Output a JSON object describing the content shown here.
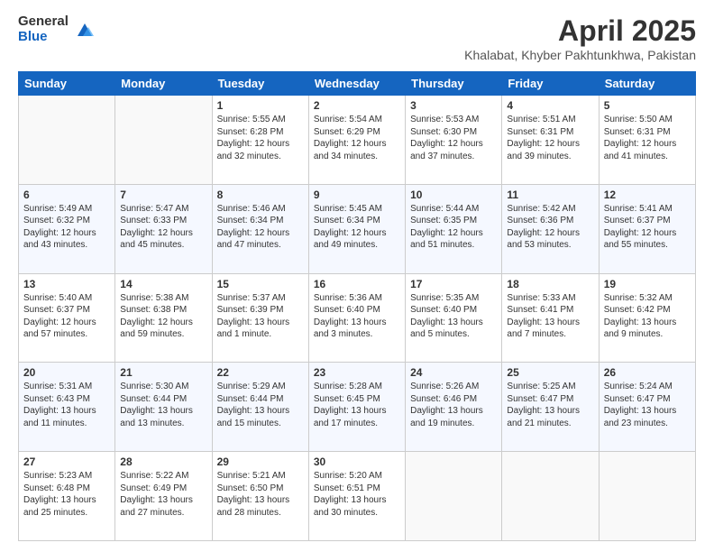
{
  "logo": {
    "general": "General",
    "blue": "Blue"
  },
  "title": "April 2025",
  "location": "Khalabat, Khyber Pakhtunkhwa, Pakistan",
  "days_of_week": [
    "Sunday",
    "Monday",
    "Tuesday",
    "Wednesday",
    "Thursday",
    "Friday",
    "Saturday"
  ],
  "weeks": [
    [
      {
        "day": "",
        "info": ""
      },
      {
        "day": "",
        "info": ""
      },
      {
        "day": "1",
        "info": "Sunrise: 5:55 AM\nSunset: 6:28 PM\nDaylight: 12 hours and 32 minutes."
      },
      {
        "day": "2",
        "info": "Sunrise: 5:54 AM\nSunset: 6:29 PM\nDaylight: 12 hours and 34 minutes."
      },
      {
        "day": "3",
        "info": "Sunrise: 5:53 AM\nSunset: 6:30 PM\nDaylight: 12 hours and 37 minutes."
      },
      {
        "day": "4",
        "info": "Sunrise: 5:51 AM\nSunset: 6:31 PM\nDaylight: 12 hours and 39 minutes."
      },
      {
        "day": "5",
        "info": "Sunrise: 5:50 AM\nSunset: 6:31 PM\nDaylight: 12 hours and 41 minutes."
      }
    ],
    [
      {
        "day": "6",
        "info": "Sunrise: 5:49 AM\nSunset: 6:32 PM\nDaylight: 12 hours and 43 minutes."
      },
      {
        "day": "7",
        "info": "Sunrise: 5:47 AM\nSunset: 6:33 PM\nDaylight: 12 hours and 45 minutes."
      },
      {
        "day": "8",
        "info": "Sunrise: 5:46 AM\nSunset: 6:34 PM\nDaylight: 12 hours and 47 minutes."
      },
      {
        "day": "9",
        "info": "Sunrise: 5:45 AM\nSunset: 6:34 PM\nDaylight: 12 hours and 49 minutes."
      },
      {
        "day": "10",
        "info": "Sunrise: 5:44 AM\nSunset: 6:35 PM\nDaylight: 12 hours and 51 minutes."
      },
      {
        "day": "11",
        "info": "Sunrise: 5:42 AM\nSunset: 6:36 PM\nDaylight: 12 hours and 53 minutes."
      },
      {
        "day": "12",
        "info": "Sunrise: 5:41 AM\nSunset: 6:37 PM\nDaylight: 12 hours and 55 minutes."
      }
    ],
    [
      {
        "day": "13",
        "info": "Sunrise: 5:40 AM\nSunset: 6:37 PM\nDaylight: 12 hours and 57 minutes."
      },
      {
        "day": "14",
        "info": "Sunrise: 5:38 AM\nSunset: 6:38 PM\nDaylight: 12 hours and 59 minutes."
      },
      {
        "day": "15",
        "info": "Sunrise: 5:37 AM\nSunset: 6:39 PM\nDaylight: 13 hours and 1 minute."
      },
      {
        "day": "16",
        "info": "Sunrise: 5:36 AM\nSunset: 6:40 PM\nDaylight: 13 hours and 3 minutes."
      },
      {
        "day": "17",
        "info": "Sunrise: 5:35 AM\nSunset: 6:40 PM\nDaylight: 13 hours and 5 minutes."
      },
      {
        "day": "18",
        "info": "Sunrise: 5:33 AM\nSunset: 6:41 PM\nDaylight: 13 hours and 7 minutes."
      },
      {
        "day": "19",
        "info": "Sunrise: 5:32 AM\nSunset: 6:42 PM\nDaylight: 13 hours and 9 minutes."
      }
    ],
    [
      {
        "day": "20",
        "info": "Sunrise: 5:31 AM\nSunset: 6:43 PM\nDaylight: 13 hours and 11 minutes."
      },
      {
        "day": "21",
        "info": "Sunrise: 5:30 AM\nSunset: 6:44 PM\nDaylight: 13 hours and 13 minutes."
      },
      {
        "day": "22",
        "info": "Sunrise: 5:29 AM\nSunset: 6:44 PM\nDaylight: 13 hours and 15 minutes."
      },
      {
        "day": "23",
        "info": "Sunrise: 5:28 AM\nSunset: 6:45 PM\nDaylight: 13 hours and 17 minutes."
      },
      {
        "day": "24",
        "info": "Sunrise: 5:26 AM\nSunset: 6:46 PM\nDaylight: 13 hours and 19 minutes."
      },
      {
        "day": "25",
        "info": "Sunrise: 5:25 AM\nSunset: 6:47 PM\nDaylight: 13 hours and 21 minutes."
      },
      {
        "day": "26",
        "info": "Sunrise: 5:24 AM\nSunset: 6:47 PM\nDaylight: 13 hours and 23 minutes."
      }
    ],
    [
      {
        "day": "27",
        "info": "Sunrise: 5:23 AM\nSunset: 6:48 PM\nDaylight: 13 hours and 25 minutes."
      },
      {
        "day": "28",
        "info": "Sunrise: 5:22 AM\nSunset: 6:49 PM\nDaylight: 13 hours and 27 minutes."
      },
      {
        "day": "29",
        "info": "Sunrise: 5:21 AM\nSunset: 6:50 PM\nDaylight: 13 hours and 28 minutes."
      },
      {
        "day": "30",
        "info": "Sunrise: 5:20 AM\nSunset: 6:51 PM\nDaylight: 13 hours and 30 minutes."
      },
      {
        "day": "",
        "info": ""
      },
      {
        "day": "",
        "info": ""
      },
      {
        "day": "",
        "info": ""
      }
    ]
  ]
}
